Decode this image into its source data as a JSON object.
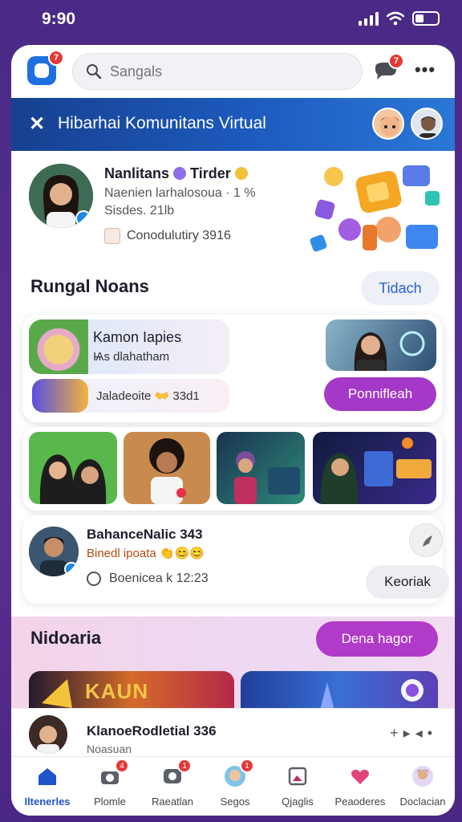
{
  "status_bar": {
    "time": "9:90"
  },
  "header": {
    "logo_badge": "7",
    "search_placeholder": "Sangals",
    "messages_badge": "7",
    "more_label": "•••"
  },
  "banner": {
    "title": "Hibarhai Komunitans Virtual"
  },
  "profile": {
    "name": "Nanlitans",
    "name_suffix": "Tirder",
    "line1": "Naenien larhalosoua · 1 %",
    "line2": "Sisdes. 21lb",
    "tag": "Conodulutiry 3916"
  },
  "rooms": {
    "title": "Rungal Noans",
    "see_all": "Tidach",
    "card1_title": "Kamon Iapies",
    "card1_sub": "Ѩs dlahatham",
    "card2_text": "Jaladeoite 👐 33d1",
    "join_button": "Ponnifleah"
  },
  "activity": {
    "name": "BahanceNalic 343",
    "sub": "Binedl ipoata 👏😊😊",
    "time": "Boenicea k 12:23",
    "action": "Keoriak"
  },
  "promo": {
    "title": "Nidoaria",
    "button": "Dena hagor",
    "banner1_text": "KAUN"
  },
  "overlay": {
    "name": "KlanoeRodletial 336",
    "sub": "Noasuan"
  },
  "nav": [
    {
      "label": "Iltenerles"
    },
    {
      "label": "Plomle",
      "badge": "4"
    },
    {
      "label": "Raeatlan",
      "badge": "1"
    },
    {
      "label": "Segos",
      "badge": "1"
    },
    {
      "label": "Qjaglis"
    },
    {
      "label": "Peaoderes"
    },
    {
      "label": "Doclacian"
    }
  ],
  "colors": {
    "background": "#4a2a86",
    "brand_blue": "#1f6fe0",
    "accent_purple": "#a438c7",
    "badge_red": "#e53935"
  }
}
